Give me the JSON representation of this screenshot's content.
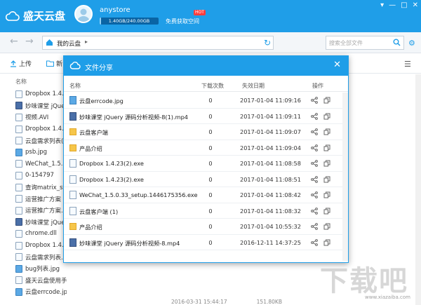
{
  "app": {
    "name": "盛天云盘"
  },
  "user": {
    "name": "anystore",
    "quota_text": "1.40GB/240.00GB",
    "quota_fraction": 0.006,
    "get_space": "免费获取空间",
    "hot_badge": "HOT"
  },
  "nav": {
    "path": "我的云盘",
    "search_placeholder": "搜索全部文件"
  },
  "toolbar": {
    "upload": "上传",
    "new_partial": "新"
  },
  "columns": {
    "name": "名称"
  },
  "background_files": [
    {
      "name": "Dropbox 1.4.2",
      "kind": "file"
    },
    {
      "name": "妙味课堂 jQuer",
      "kind": "video"
    },
    {
      "name": "视频.AVI",
      "kind": "file"
    },
    {
      "name": "Dropbox 1.4.2",
      "kind": "file"
    },
    {
      "name": "云盘需求列表(1)",
      "kind": "file"
    },
    {
      "name": "psb.jpg",
      "kind": "img"
    },
    {
      "name": "WeChat_1.5.0.3",
      "kind": "file"
    },
    {
      "name": "0-154797",
      "kind": "file"
    },
    {
      "name": "查询matrix_syn",
      "kind": "file"
    },
    {
      "name": "运营推广方案",
      "kind": "file"
    },
    {
      "name": "运营推广方案.d",
      "kind": "file"
    },
    {
      "name": "妙味课堂 jQuer",
      "kind": "video"
    },
    {
      "name": "chrome.dll",
      "kind": "file"
    },
    {
      "name": "Dropbox 1.4.2",
      "kind": "file"
    },
    {
      "name": "云盘需求列表.xl",
      "kind": "file"
    },
    {
      "name": "bug列表.jpg",
      "kind": "img"
    },
    {
      "name": "盛天云盘使用手",
      "kind": "file"
    },
    {
      "name": "云盘errcode.jpg",
      "kind": "img"
    }
  ],
  "background_bottom": {
    "date": "2016-03-31 15:44:17",
    "size": "151.80KB"
  },
  "dialog": {
    "title": "文件分享",
    "headers": {
      "name": "名称",
      "downloads": "下载次数",
      "expire": "失效日期",
      "action": "操作"
    },
    "rows": [
      {
        "name": "云盘errcode.jpg",
        "kind": "img",
        "downloads": "0",
        "expire": "2017-01-04 11:09:16"
      },
      {
        "name": "妙味课堂 jQuery 源码分析视频-8(1).mp4",
        "kind": "video",
        "downloads": "0",
        "expire": "2017-01-04 11:09:11"
      },
      {
        "name": "云盘客户端",
        "kind": "folder",
        "downloads": "0",
        "expire": "2017-01-04 11:09:07"
      },
      {
        "name": "产品介绍",
        "kind": "folder",
        "downloads": "0",
        "expire": "2017-01-04 11:09:04"
      },
      {
        "name": "Dropbox 1.4.23(2).exe",
        "kind": "file",
        "downloads": "0",
        "expire": "2017-01-04 11:08:58"
      },
      {
        "name": "Dropbox 1.4.23(2).exe",
        "kind": "file",
        "downloads": "0",
        "expire": "2017-01-04 11:08:51"
      },
      {
        "name": "WeChat_1.5.0.33_setup.1446175356.exe",
        "kind": "file",
        "downloads": "0",
        "expire": "2017-01-04 11:08:42"
      },
      {
        "name": "云盘客户端 (1)",
        "kind": "file",
        "downloads": "0",
        "expire": "2017-01-04 11:08:32"
      },
      {
        "name": "产品介绍",
        "kind": "folder",
        "downloads": "0",
        "expire": "2017-01-04 10:55:32"
      },
      {
        "name": "妙味课堂 jQuery 源码分析视频-8.mp4",
        "kind": "video",
        "downloads": "0",
        "expire": "2016-12-11 14:37:25"
      }
    ]
  },
  "watermark": {
    "text": "下载吧",
    "site": "www.xiazaiba.com"
  },
  "colors": {
    "accent": "#1f9ee8"
  }
}
